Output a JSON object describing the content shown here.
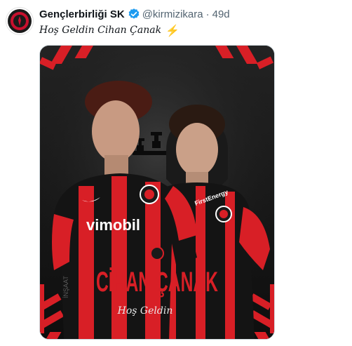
{
  "tweet": {
    "display_name": "Gençlerbirliği SK",
    "handle": "@kirmizikara",
    "separator": "·",
    "time": "49d",
    "text": "Hoş Geldin Cihan Çanak",
    "emoji": "⚡",
    "verified_color": "#1d9bf0"
  },
  "media": {
    "sponsor": "vimobil",
    "shirt_brand": "FirstEnergy",
    "kit_maker_side_text": "İNŞAAT",
    "player_name": "CİHAN ÇANAK",
    "subtitle": "Hoş Geldin",
    "colors": {
      "red": "#d81f26",
      "black": "#141414",
      "background": "#1b1b1b"
    }
  }
}
